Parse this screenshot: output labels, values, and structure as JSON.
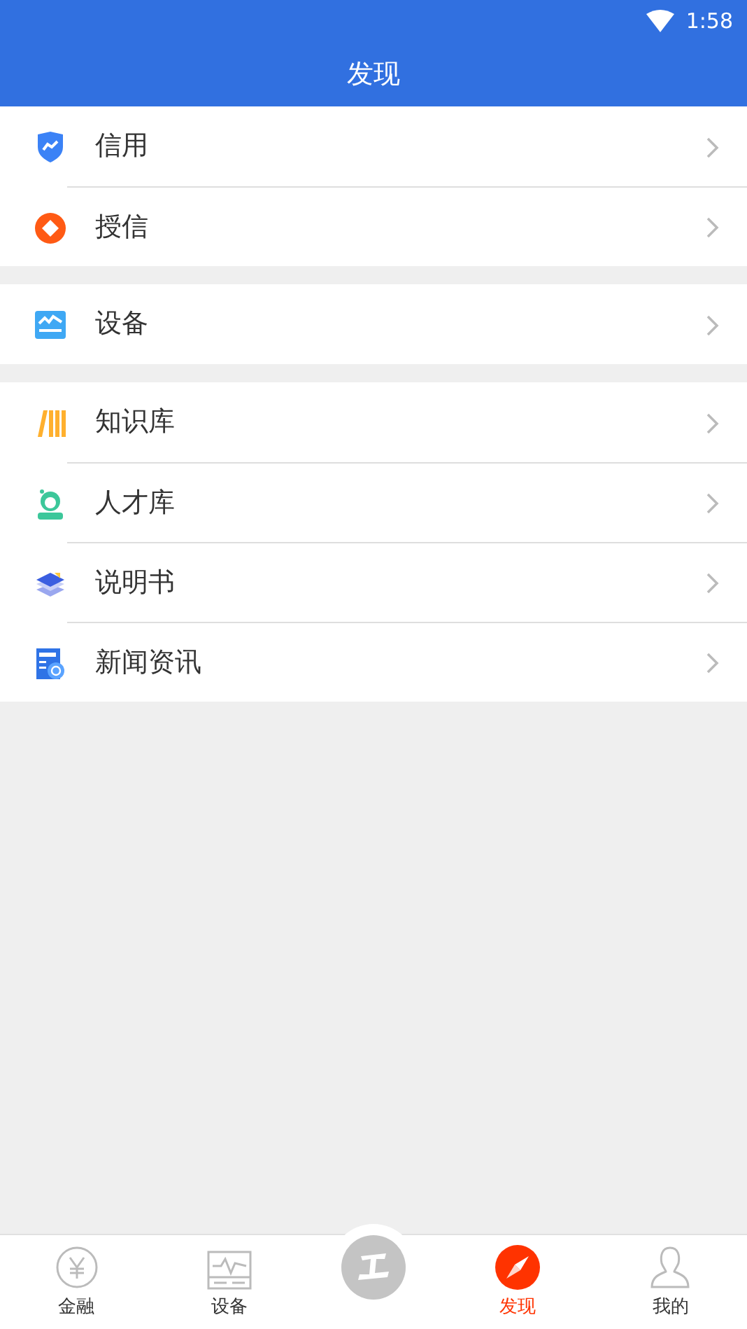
{
  "status_bar": {
    "time": "1:58"
  },
  "header": {
    "title": "发现"
  },
  "groups": [
    {
      "items": [
        {
          "label": "信用",
          "kind": "shield"
        },
        {
          "label": "授信",
          "kind": "coin"
        }
      ]
    },
    {
      "items": [
        {
          "label": "设备",
          "kind": "device"
        }
      ]
    },
    {
      "items": [
        {
          "label": "知识库",
          "kind": "books"
        },
        {
          "label": "人才库",
          "kind": "talent"
        },
        {
          "label": "说明书",
          "kind": "manual"
        },
        {
          "label": "新闻资讯",
          "kind": "news"
        }
      ]
    }
  ],
  "bottom_nav": [
    {
      "label": "金融",
      "kind": "yen",
      "selected": false
    },
    {
      "label": "设备",
      "kind": "monitor",
      "selected": false
    },
    {
      "kind": "center"
    },
    {
      "label": "发现",
      "kind": "compass",
      "selected": true
    },
    {
      "label": "我的",
      "kind": "user",
      "selected": false
    }
  ]
}
